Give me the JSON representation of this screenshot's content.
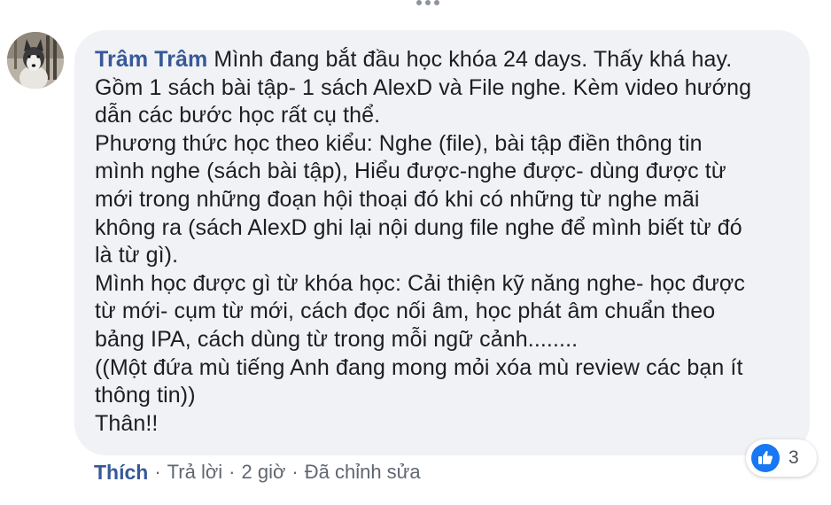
{
  "comment": {
    "author": "Trâm Trâm",
    "lines": [
      " Mình đang bắt đầu học khóa 24 days. Thấy khá hay.",
      "Gồm 1 sách bài tập- 1 sách AlexD và File nghe. Kèm video hướng",
      "dẫn các bước học rất cụ thể.",
      "Phương thức học theo kiểu: Nghe (file), bài tập điền thông tin",
      "mình nghe (sách bài tập), Hiểu được-nghe được- dùng được từ",
      "mới trong những đoạn hội thoại đó khi có những từ nghe mãi",
      "không ra (sách AlexD ghi lại nội dung file nghe để mình biết từ đó",
      "là từ gì).",
      "Mình học được gì từ khóa học: Cải thiện kỹ năng nghe- học được",
      "từ mới- cụm từ mới, cách đọc nối âm, học phát âm chuẩn theo",
      "bảng IPA, cách dùng từ trong mỗi ngữ cảnh........",
      "((Một đứa mù tiếng Anh đang mong mỏi xóa mù review các bạn ít",
      "thông tin))",
      "Thân!!"
    ]
  },
  "reactions": {
    "icon": "thumbs-up-icon",
    "count": "3",
    "color": "#1877f2"
  },
  "actions": {
    "like": "Thích",
    "reply": "Trả lời",
    "time": "2 giờ",
    "edited": "Đã chỉnh sửa",
    "separator": "·"
  },
  "colors": {
    "link": "#385898",
    "bubble": "#f0f2f5",
    "text": "#1c1e21",
    "meta": "#606770"
  }
}
